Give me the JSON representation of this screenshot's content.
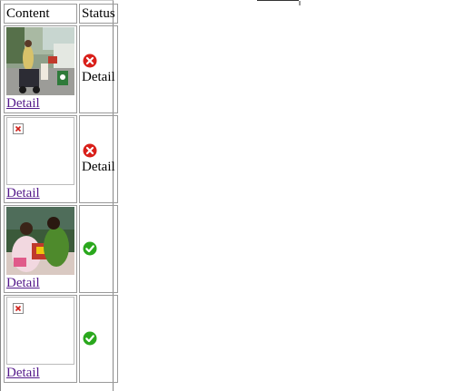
{
  "table": {
    "headers": {
      "content": "Content",
      "status": "Status"
    },
    "rows": [
      {
        "thumbnail": "photo-street",
        "link": "Detail",
        "status_icon": "error-icon",
        "status_text": "Detail"
      },
      {
        "thumbnail": "broken-image",
        "link": "Detail",
        "status_icon": "error-icon",
        "status_text": "Detail"
      },
      {
        "thumbnail": "photo-family",
        "link": "Detail",
        "status_icon": "check-icon",
        "status_text": ""
      },
      {
        "thumbnail": "broken-image",
        "link": "Detail",
        "status_icon": "check-icon",
        "status_text": ""
      }
    ]
  },
  "colors": {
    "link": "#551a8b",
    "error": "#d9201a",
    "ok": "#2aa81d"
  }
}
